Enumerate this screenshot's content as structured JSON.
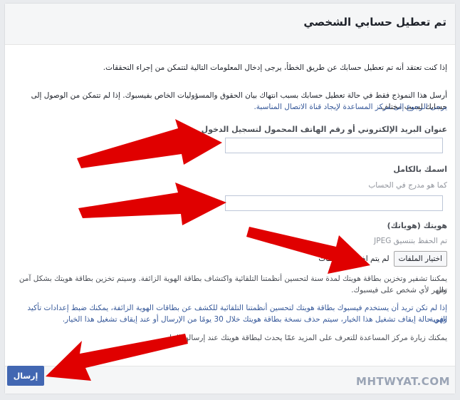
{
  "header": {
    "title": "تم تعطيل حسابي الشخصي"
  },
  "intro": {
    "line1": "إذا كنت تعتقد أنه تم تعطيل حسابك عن طريق الخطأ، يرجى إدخال المعلومات التالية لتتمكن من إجراء التحققات.",
    "line2a": "أرسل هذا النموذج فقط في حالة تعطيل حسابك بسبب انتهاك بيان الحقوق والمسؤوليات الخاص بفيسبوك. إذا لم تتمكن من الوصول إلى حسابك لسبب مختلف،",
    "line2b": "يرجى الرجوع إلى مركز المساعدة لإيجاد قناة الاتصال المناسبة."
  },
  "form": {
    "email_label": "عنوان البريد الإلكتروني أو رقم الهاتف المحمول لتسجيل الدخول",
    "email_value": "",
    "name_label": "اسمك بالكامل",
    "name_hint": "كما هو مدرج في الحساب",
    "name_value": "",
    "id_label": "هويتك (هوياتك)",
    "id_hint": "تم الحفظ بتنسيق JPEG",
    "file_button": "اختيار الملفات",
    "file_status": "لم يتم اختيار أي ملفات"
  },
  "notes": {
    "p1a": "يمكننا تشفير وتخزين بطاقة هويتك لمدة سنة لتحسين أنظمتنا التلقائية واكتشاف بطاقة الهوية الزائفة. وسيتم تخزين بطاقة هويتك بشكل آمن ولن",
    "p1b": "تظهر لأي شخص على فيسبوك.",
    "p2a": "إذا لم تكن تريد أن يستخدم فيسبوك بطاقة هويتك لتحسين أنظمتنا التلقائية للكشف عن بطاقات الهوية الزائفة، يمكنك ضبط إعدادات تأكيد الهوية.",
    "p2b": "وفي حالة إيقاف تشغيل هذا الخيار، سيتم حذف نسخة بطاقة هويتك خلال 30 يومًا من الإرسال أو عند إيقاف تشغيل هذا الخيار.",
    "p3": "يمكنك زيارة مركز المساعدة للتعرف على المزيد عمّا يحدث لبطاقة هويتك عند إرسالها إلينا."
  },
  "footer": {
    "submit_label": "إرسال"
  },
  "watermark": "MHTWYAT.COM",
  "colors": {
    "arrow": "#e00000",
    "button": "#4267b2",
    "link": "#365899"
  }
}
